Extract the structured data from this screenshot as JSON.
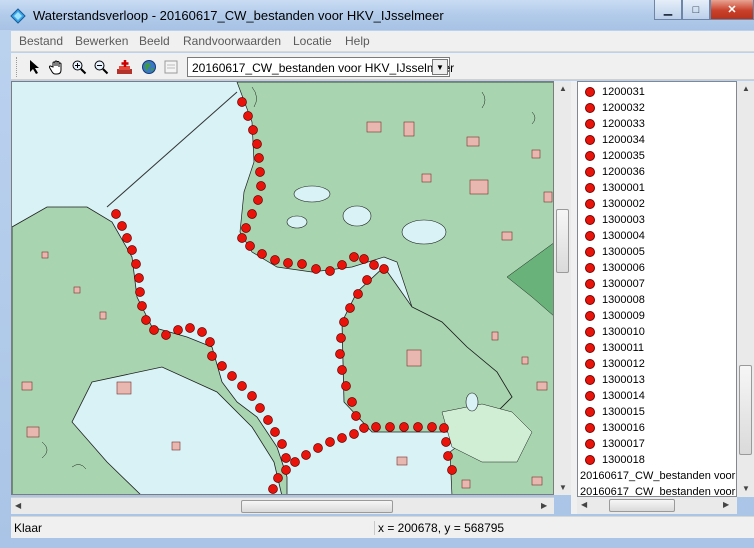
{
  "window": {
    "title": "Waterstandsverloop - 20160617_CW_bestanden voor HKV_IJsselmeer",
    "icon": "diamond-app-icon",
    "controls": {
      "minimize": "▁",
      "maximize": "□",
      "close": "✕"
    }
  },
  "menu": [
    "Bestand",
    "Bewerken",
    "Beeld",
    "Randvoorwaarden",
    "Locatie",
    "Help"
  ],
  "toolbar": {
    "tools": [
      "arrow-select-icon",
      "pan-hand-icon",
      "zoom-in-icon",
      "zoom-out-icon",
      "add-location-icon",
      "globe-icon",
      "layer-icon"
    ],
    "dataset_select": "20160617_CW_bestanden voor HKV_IJsselmeer"
  },
  "locations": [
    "1200031",
    "1200032",
    "1200033",
    "1200034",
    "1200035",
    "1200036",
    "1300001",
    "1300002",
    "1300003",
    "1300004",
    "1300005",
    "1300006",
    "1300007",
    "1300008",
    "1300009",
    "1300010",
    "1300011",
    "1300012",
    "1300013",
    "1300014",
    "1300015",
    "1300016",
    "1300017",
    "1300018"
  ],
  "datasets": [
    "20160617_CW_bestanden voor",
    "20160617_CW_bestanden voor"
  ],
  "colors": {
    "water": "#d8f2f6",
    "land": "#a8d5b0",
    "location_marker": "#e8140b",
    "built_area": "#e8b8b0"
  },
  "status": {
    "text": "Klaar",
    "coordinates": "x = 200678, y = 568795"
  }
}
